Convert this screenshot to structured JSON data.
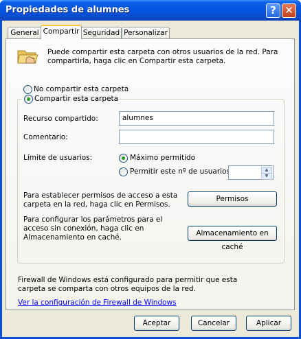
{
  "window": {
    "title": "Propiedades de alumnes",
    "help_glyph": "?",
    "close_glyph": "✕"
  },
  "tabs": [
    {
      "label": "General"
    },
    {
      "label": "Compartir"
    },
    {
      "label": "Seguridad"
    },
    {
      "label": "Personalizar"
    }
  ],
  "share": {
    "intro_text": "Puede compartir esta carpeta con otros usuarios de la red. Para compartirla, haga clic en Compartir esta carpeta.",
    "no_share_label": "No compartir esta carpeta",
    "share_label": "Compartir esta carpeta",
    "selected_option": "Compartir esta carpeta",
    "share_name_label": "Recurso compartido:",
    "share_name_value": "alumnes",
    "comment_label": "Comentario:",
    "comment_value": "",
    "user_limit_label": "Límite de usuarios:",
    "max_allowed_label": "Máximo permitido",
    "allow_n_label": "Permitir este nº de usuarios:",
    "allow_n_value": "",
    "user_limit_selected": "Máximo permitido",
    "permissions_text": "Para establecer permisos de acceso a esta carpeta en la red, haga clic en Permisos.",
    "permissions_button": "Permisos",
    "caching_text": "Para configurar los parámetros para el acceso sin conexión, haga clic en Almacenamiento en caché.",
    "caching_button": "Almacenamiento en caché",
    "firewall_text": "Firewall de Windows está configurado para permitir que esta carpeta se comparta con otros equipos de la red.",
    "firewall_link": "Ver la configuración de Firewall de Windows"
  },
  "buttons": {
    "ok": "Aceptar",
    "cancel": "Cancelar",
    "apply": "Aplicar"
  },
  "icons": {
    "folder": "share-folder-icon",
    "spin_up": "spin-up-icon",
    "spin_down": "spin-down-icon"
  }
}
